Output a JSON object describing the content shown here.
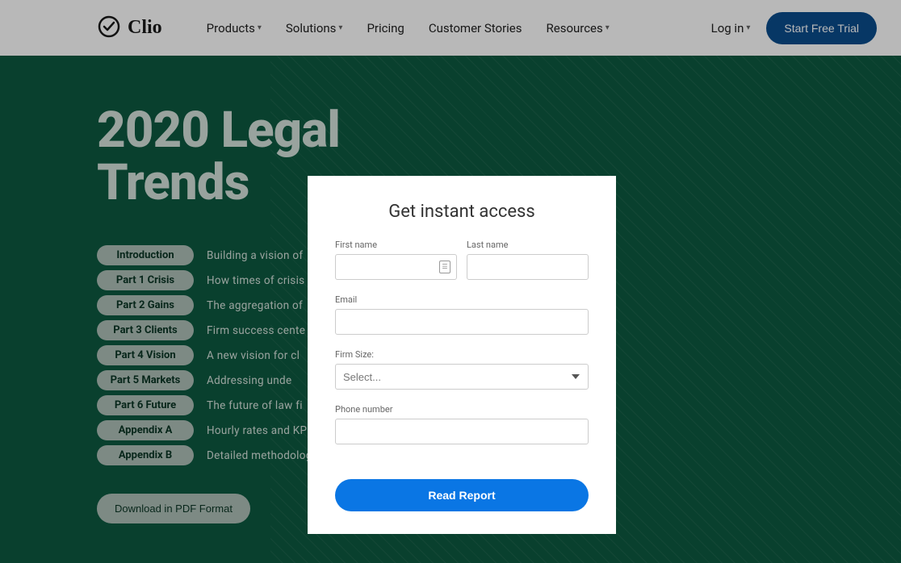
{
  "header": {
    "logo_text": "Clio",
    "nav": {
      "products": "Products",
      "solutions": "Solutions",
      "pricing": "Pricing",
      "customer_stories": "Customer Stories",
      "resources": "Resources"
    },
    "login": "Log in",
    "trial": "Start Free Trial"
  },
  "hero": {
    "title_line1": "2020 Legal",
    "title_line2": "Trends",
    "toc": [
      {
        "pill": "Introduction",
        "desc": "Building a vision of"
      },
      {
        "pill": "Part 1 Crisis",
        "desc": "How times of crisis"
      },
      {
        "pill": "Part 2 Gains",
        "desc": "The aggregation of"
      },
      {
        "pill": "Part 3 Clients",
        "desc": "Firm success cente"
      },
      {
        "pill": "Part 4 Vision",
        "desc": "A new vision for cl"
      },
      {
        "pill": "Part 5 Markets",
        "desc": "Addressing unde"
      },
      {
        "pill": "Part 6 Future",
        "desc": "The future of law fi"
      },
      {
        "pill": "Appendix A",
        "desc": "Hourly rates and KP"
      },
      {
        "pill": "Appendix B",
        "desc": "Detailed methodolog"
      }
    ],
    "download": "Download in PDF Format"
  },
  "modal": {
    "title": "Get instant access",
    "labels": {
      "first_name": "First name",
      "last_name": "Last name",
      "email": "Email",
      "firm_size": "Firm Size:",
      "phone": "Phone number"
    },
    "firm_size_placeholder": "Select...",
    "submit": "Read Report"
  }
}
